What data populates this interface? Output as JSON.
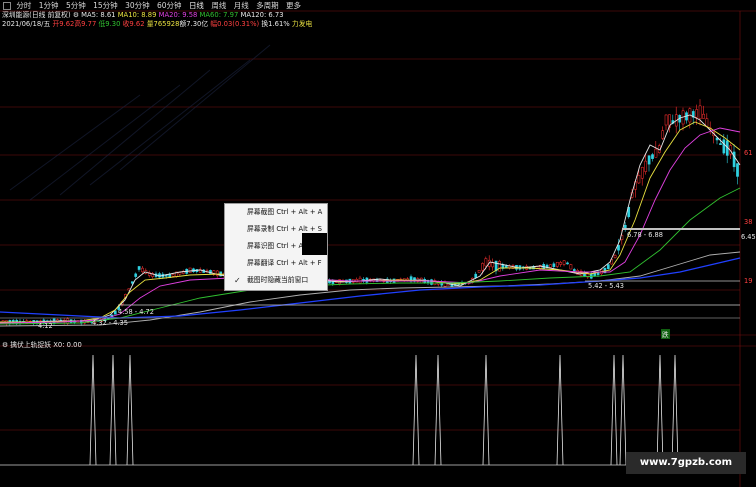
{
  "tabs": [
    "分时",
    "1分钟",
    "5分钟",
    "15分钟",
    "30分钟",
    "60分钟",
    "日线",
    "周线",
    "月线",
    "多周期",
    "更多"
  ],
  "info_line1": {
    "stock": "深圳能源(日线 前复权)",
    "ma5": "MA5: 8.61",
    "ma10": "MA10: 8.89",
    "ma20": "MA20: 9.58",
    "ma60": "MA60: 7.97",
    "ma120": "MA120: 6.73"
  },
  "info_line2": {
    "date": "2021/06/18/五",
    "open": "开9.62",
    "high": "高9.77",
    "low": "低9.30",
    "close": "收9.62",
    "volume": "量765928",
    "amount": "额7.30亿",
    "change": "幅0.03(0.31%)",
    "turnover": "换1.61%",
    "sector": "力发电"
  },
  "price_labels": {
    "r1": "61",
    "r2": "38",
    "r3": "6.45",
    "r4": "19",
    "box1": "6.78 - 6.88",
    "box2": "5.42 - 5.43",
    "box3": "4.58 - 4.72",
    "box4": "4.32 - 4.35",
    "low": "4.12",
    "signal": "跌"
  },
  "indicator_label": "擒伏上轨捉妖 X0: 0.00",
  "context_menu": {
    "items": [
      "屏幕截图 Ctrl + Alt + A",
      "屏幕录制 Ctrl + Alt + S",
      "屏幕识图 Ctrl + Alt",
      "屏幕翻译 Ctrl + Alt + F",
      "截图时隐藏当前窗口"
    ]
  },
  "watermark": "www.7gpzb.com",
  "colors": {
    "up": "#ff3030",
    "down": "#30d0e0",
    "ma5": "#e6e6e6",
    "ma10": "#e8e040",
    "ma20": "#e040e0",
    "ma60": "#30c030",
    "ma120": "#8080ff",
    "long_ma": "#2040ff"
  }
}
